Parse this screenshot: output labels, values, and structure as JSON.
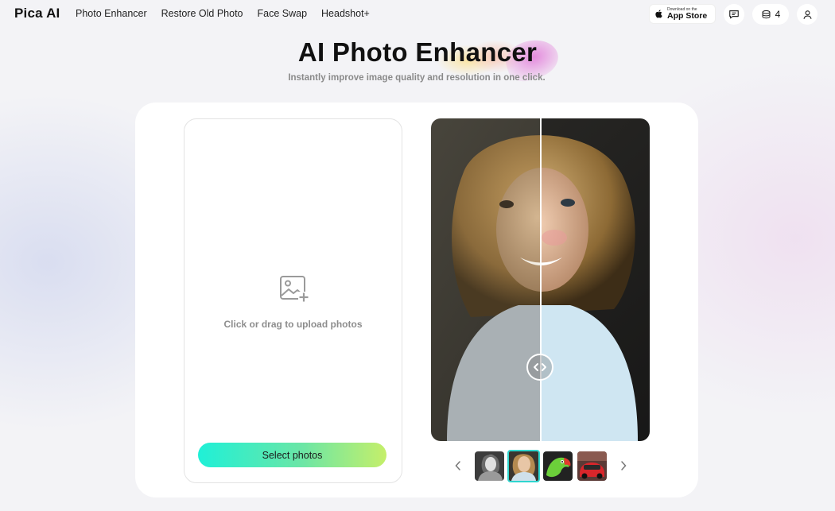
{
  "nav": {
    "logo": "Pica AI",
    "links": [
      "Photo Enhancer",
      "Restore Old Photo",
      "Face Swap",
      "Headshot+"
    ],
    "app_store": {
      "small": "Download on the",
      "big": "App Store"
    },
    "credits": "4",
    "icons": [
      "apple-icon",
      "message-icon",
      "coins-stack-icon",
      "user-icon"
    ]
  },
  "hero": {
    "title": "AI Photo Enhancer",
    "subtitle": "Instantly improve image quality and resolution in one click."
  },
  "upload": {
    "hint": "Click or drag to upload photos",
    "button": "Select photos",
    "icon": "image-add-icon"
  },
  "preview": {
    "icons": [
      "compare-slider-handle-icon",
      "chevron-left-icon",
      "chevron-right-icon"
    ],
    "thumbnails": [
      "woman-bw",
      "woman-smiling",
      "parrot",
      "red-car"
    ],
    "selected_thumbnail": 2
  },
  "colors": {
    "accent_teal": "#1ff0d7",
    "accent_lime": "#c5ef6a",
    "thumb_border": "#2fd6cf"
  }
}
